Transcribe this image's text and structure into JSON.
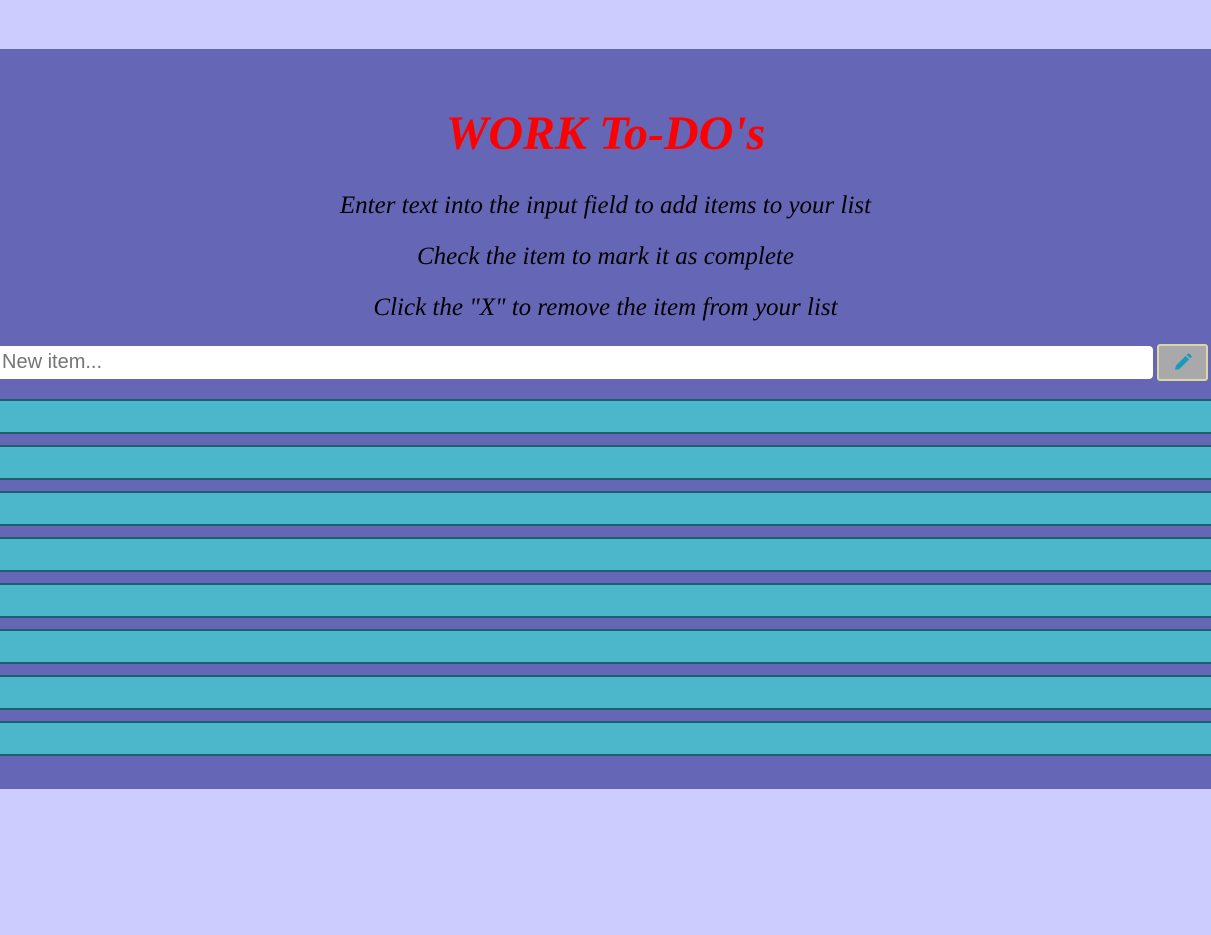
{
  "header": {
    "title": "WORK To-DO's",
    "instructions": [
      "Enter text into the input field to add items to your list",
      "Check the item to mark it as complete",
      "Click the \"X\" to remove the item from your list"
    ]
  },
  "form": {
    "placeholder": "New item...",
    "value": "",
    "add_button_icon": "pencil-icon"
  },
  "todo_list": {
    "row_count": 8,
    "items": [
      "",
      "",
      "",
      "",
      "",
      "",
      "",
      ""
    ]
  },
  "colors": {
    "page_background": "#ccccfe",
    "panel_background": "#6666b6",
    "title": "#ff0000",
    "row_fill": "#4cb6cb",
    "row_border": "#1d5f6f",
    "button_background": "#a9a9ac",
    "pencil_icon": "#1a9ab8"
  }
}
